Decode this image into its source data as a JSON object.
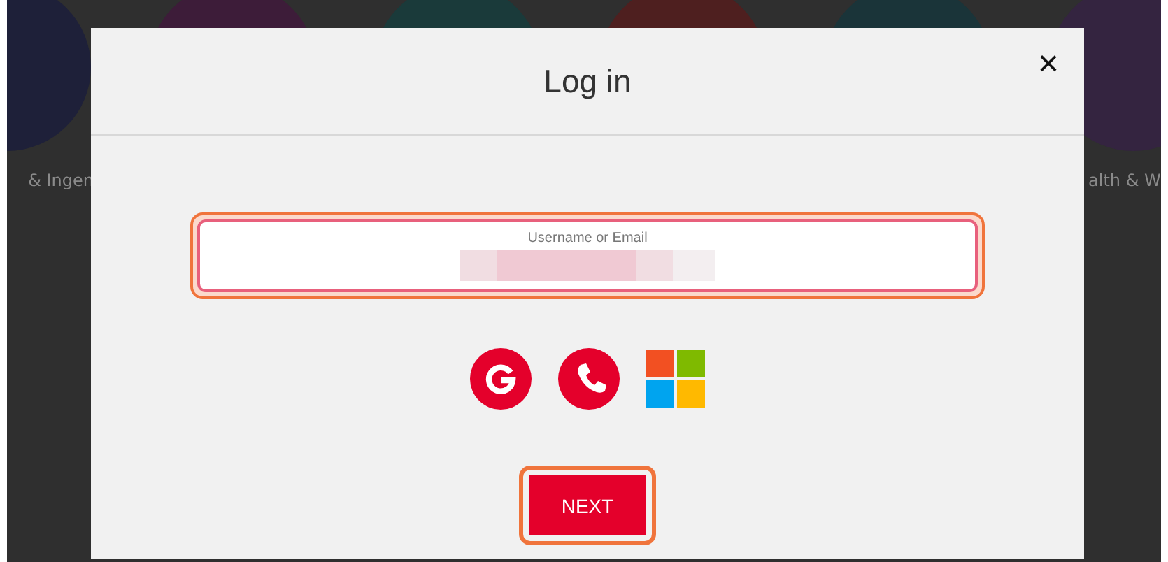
{
  "background": {
    "categories": [
      {
        "label": "& Ingen",
        "color": "#1e2039"
      },
      {
        "color": "#3d1c39"
      },
      {
        "color": "#1a3a3a"
      },
      {
        "color": "#4e1f1f"
      },
      {
        "color": "#1a3439"
      },
      {
        "label": "alth & W",
        "color": "#342440"
      }
    ]
  },
  "dialog": {
    "title": "Log in",
    "close": "×",
    "field": {
      "label": "Username or Email",
      "focused": true,
      "redacted": true
    },
    "social": [
      {
        "kind": "google"
      },
      {
        "kind": "phone"
      },
      {
        "kind": "microsoft"
      }
    ],
    "next": {
      "label": "NEXT",
      "focused": true
    }
  }
}
